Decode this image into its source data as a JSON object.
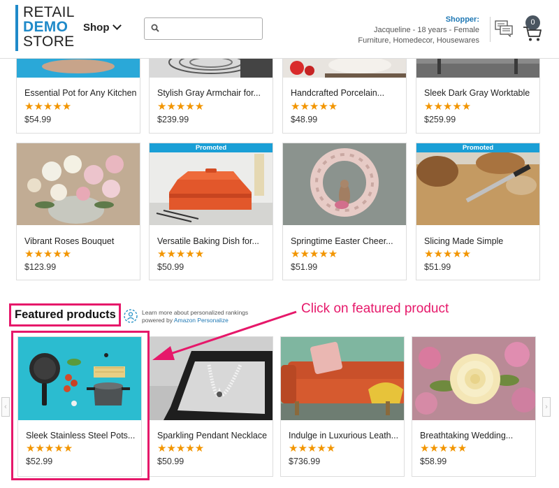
{
  "header": {
    "logo": {
      "line1": "RETAIL",
      "line2": "DEMO",
      "line3": "STORE"
    },
    "shop_label": "Shop",
    "search_placeholder": "",
    "shopper": {
      "label": "Shopper:",
      "line1": "Jacqueline - 18 years - Female",
      "line2": "Furniture, Homedecor, Housewares"
    },
    "cart_count": "0"
  },
  "grid_row1": [
    {
      "name": "Essential Pot for Any Kitchen",
      "stars": "★★★★★",
      "price": "$54.99"
    },
    {
      "name": "Stylish Gray Armchair for...",
      "stars": "★★★★★",
      "price": "$239.99"
    },
    {
      "name": "Handcrafted Porcelain...",
      "stars": "★★★★★",
      "price": "$48.99"
    },
    {
      "name": "Sleek Dark Gray Worktable",
      "stars": "★★★★★",
      "price": "$259.99"
    }
  ],
  "grid_row2": [
    {
      "name": "Vibrant Roses Bouquet",
      "stars": "★★★★★",
      "price": "$123.99",
      "badge": ""
    },
    {
      "name": "Versatile Baking Dish for...",
      "stars": "★★★★★",
      "price": "$50.99",
      "badge": "Promoted"
    },
    {
      "name": "Springtime Easter Cheer...",
      "stars": "★★★★★",
      "price": "$51.99",
      "badge": ""
    },
    {
      "name": "Slicing Made Simple",
      "stars": "★★★★★",
      "price": "$51.99",
      "badge": "Promoted"
    }
  ],
  "featured": {
    "title": "Featured products",
    "learn_line1": "Learn more about personalized rankings",
    "learn_prefix": "powered by ",
    "learn_link": "Amazon Personalize",
    "annotation": "Click on featured product",
    "prev_arrow": "‹",
    "next_arrow": "›",
    "items": [
      {
        "name": "Sleek Stainless Steel Pots...",
        "stars": "★★★★★",
        "price": "$52.99"
      },
      {
        "name": "Sparkling Pendant Necklace",
        "stars": "★★★★★",
        "price": "$50.99"
      },
      {
        "name": "Indulge in Luxurious Leath...",
        "stars": "★★★★★",
        "price": "$736.99"
      },
      {
        "name": "Breathtaking Wedding...",
        "stars": "★★★★★",
        "price": "$58.99"
      }
    ]
  },
  "colors": {
    "brand": "#1f8ac9",
    "star": "#f29500",
    "annotation": "#e6186a",
    "promoted": "#1a9fd6"
  }
}
